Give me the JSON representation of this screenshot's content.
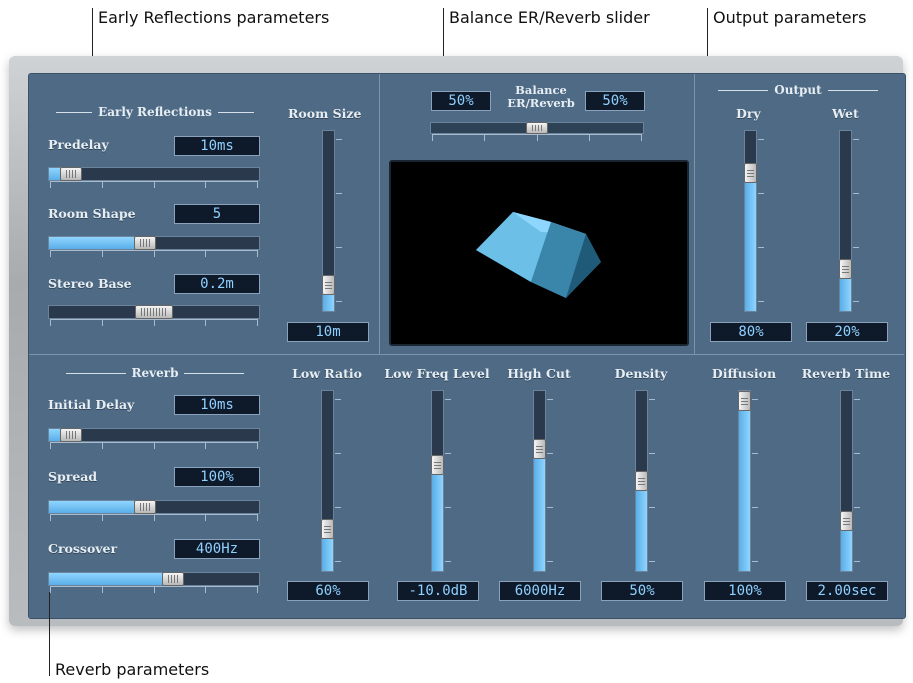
{
  "callouts": {
    "early_reflections": "Early Reflections parameters",
    "balance": "Balance ER/Reverb slider",
    "output": "Output parameters",
    "reverb": "Reverb parameters"
  },
  "early_reflections": {
    "title": "Early Reflections",
    "predelay": {
      "label": "Predelay",
      "value": "10ms",
      "level": 0.06
    },
    "room_shape": {
      "label": "Room Shape",
      "value": "5",
      "level": 0.45
    },
    "stereo_base": {
      "label": "Stereo Base",
      "value": "0.2m",
      "level": 0.5
    },
    "room_size": {
      "label": "Room Size",
      "value": "10m",
      "level": 0.1
    }
  },
  "balance": {
    "label_line1": "Balance",
    "label_line2": "ER/Reverb",
    "er_value": "50%",
    "reverb_value": "50%",
    "level": 0.5
  },
  "output": {
    "title": "Output",
    "dry": {
      "label": "Dry",
      "value": "80%",
      "level": 0.8
    },
    "wet": {
      "label": "Wet",
      "value": "20%",
      "level": 0.2
    }
  },
  "reverb": {
    "title": "Reverb",
    "initial_delay": {
      "label": "Initial Delay",
      "value": "10ms",
      "level": 0.06
    },
    "spread": {
      "label": "Spread",
      "value": "100%",
      "level": 0.45
    },
    "crossover": {
      "label": "Crossover",
      "value": "400Hz",
      "level": 0.6
    }
  },
  "vertical_params": [
    {
      "label": "Low Ratio",
      "value": "60%",
      "level": 0.2
    },
    {
      "label": "Low Freq Level",
      "value": "-10.0dB",
      "level": 0.6
    },
    {
      "label": "High Cut",
      "value": "6000Hz",
      "level": 0.7
    },
    {
      "label": "Density",
      "value": "50%",
      "level": 0.5
    },
    {
      "label": "Diffusion",
      "value": "100%",
      "level": 1.0
    },
    {
      "label": "Reverb Time",
      "value": "2.00sec",
      "level": 0.25
    }
  ],
  "colors": {
    "panel": "#4e6a85",
    "accent": "#8fd5ff",
    "value_text": "#8fd0ff"
  }
}
